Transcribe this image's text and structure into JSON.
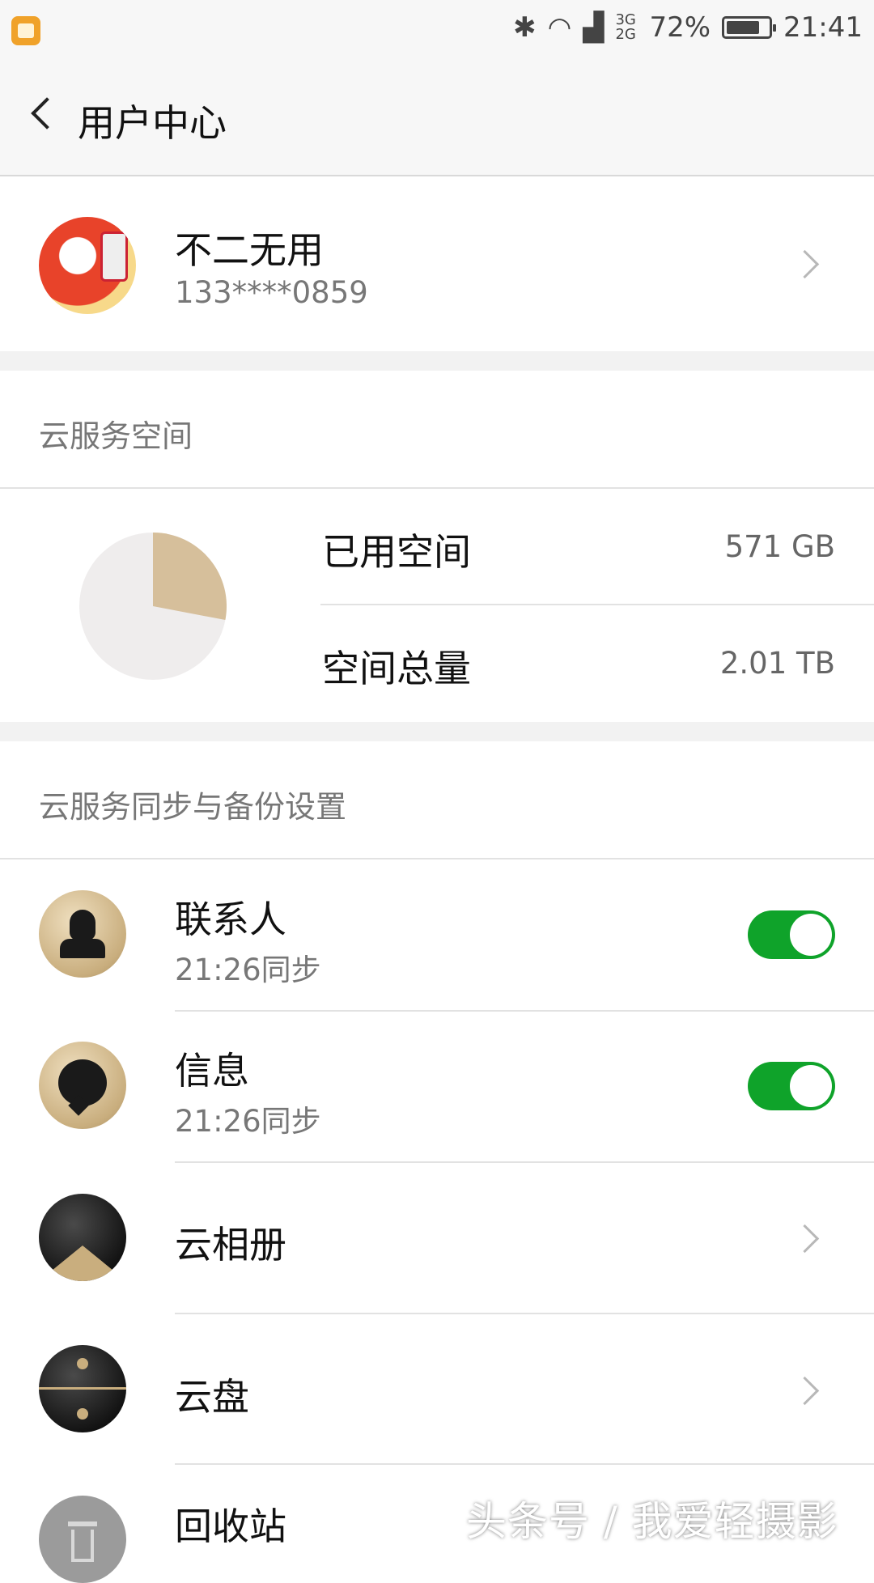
{
  "status_bar": {
    "battery": "72%",
    "time": "21:41",
    "network": "3G 2G"
  },
  "header": {
    "title": "用户中心"
  },
  "profile": {
    "name": "不二无用",
    "phone": "133****0859"
  },
  "cloud_space": {
    "section_title": "云服务空间",
    "used_label": "已用空间",
    "used_value": "571 GB",
    "total_label": "空间总量",
    "total_value": "2.01 TB",
    "used_fraction": 0.28,
    "colors": {
      "used": "#d6bf9b",
      "free": "#efeded"
    }
  },
  "sync": {
    "section_title": "云服务同步与备份设置",
    "items": [
      {
        "name": "联系人",
        "sub": "21:26同步",
        "toggle": true,
        "icon": "contacts-icon"
      },
      {
        "name": "信息",
        "sub": "21:26同步",
        "toggle": true,
        "icon": "messages-icon"
      },
      {
        "name": "云相册",
        "icon": "cloud-album-icon"
      },
      {
        "name": "云盘",
        "icon": "cloud-drive-icon"
      },
      {
        "name": "回收站",
        "icon": "recycle-bin-icon"
      }
    ]
  },
  "watermark": "头条号 / 我爱轻摄影",
  "colors": {
    "toggle_on": "#0fa32a",
    "background": "#f7f7f7"
  }
}
